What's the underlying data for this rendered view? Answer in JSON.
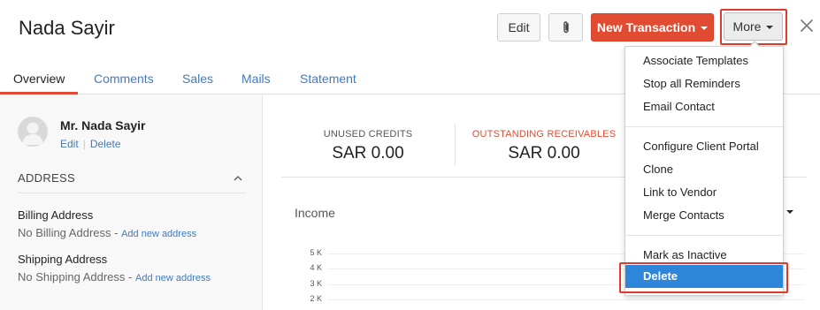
{
  "header": {
    "title": "Nada Sayir",
    "edit_label": "Edit",
    "attach_icon": "paperclip-icon",
    "new_transaction_label": "New Transaction",
    "more_label": "More",
    "close_icon": "close-icon"
  },
  "tabs": [
    {
      "label": "Overview",
      "active": true
    },
    {
      "label": "Comments",
      "active": false
    },
    {
      "label": "Sales",
      "active": false
    },
    {
      "label": "Mails",
      "active": false
    },
    {
      "label": "Statement",
      "active": false
    }
  ],
  "contact": {
    "name": "Mr. Nada Sayir",
    "edit_link": "Edit",
    "delete_link": "Delete",
    "avatar_icon": "user-avatar-icon"
  },
  "address": {
    "section_title": "ADDRESS",
    "billing_label": "Billing Address",
    "billing_value": "No Billing Address -",
    "billing_link": "Add new address",
    "shipping_label": "Shipping Address",
    "shipping_value": "No Shipping Address -",
    "shipping_link": "Add new address"
  },
  "summary": {
    "unused_credits_label": "UNUSED CREDITS",
    "unused_credits_value": "SAR 0.00",
    "outstanding_label": "OUTSTANDING RECEIVABLES",
    "outstanding_value": "SAR 0.00"
  },
  "income": {
    "title": "Income",
    "y_ticks": [
      "5 K",
      "4 K",
      "3 K",
      "2 K"
    ]
  },
  "more_menu": {
    "group1": [
      "Associate Templates",
      "Stop all Reminders",
      "Email Contact"
    ],
    "group2": [
      "Configure Client Portal",
      "Clone",
      "Link to Vendor",
      "Merge Contacts"
    ],
    "group3": [
      "Mark as Inactive"
    ],
    "highlighted": "Delete"
  },
  "colors": {
    "accent": "#e04b32",
    "link": "#3e7bbf",
    "highlight": "#2e86db",
    "annotation": "#e03a2e"
  }
}
